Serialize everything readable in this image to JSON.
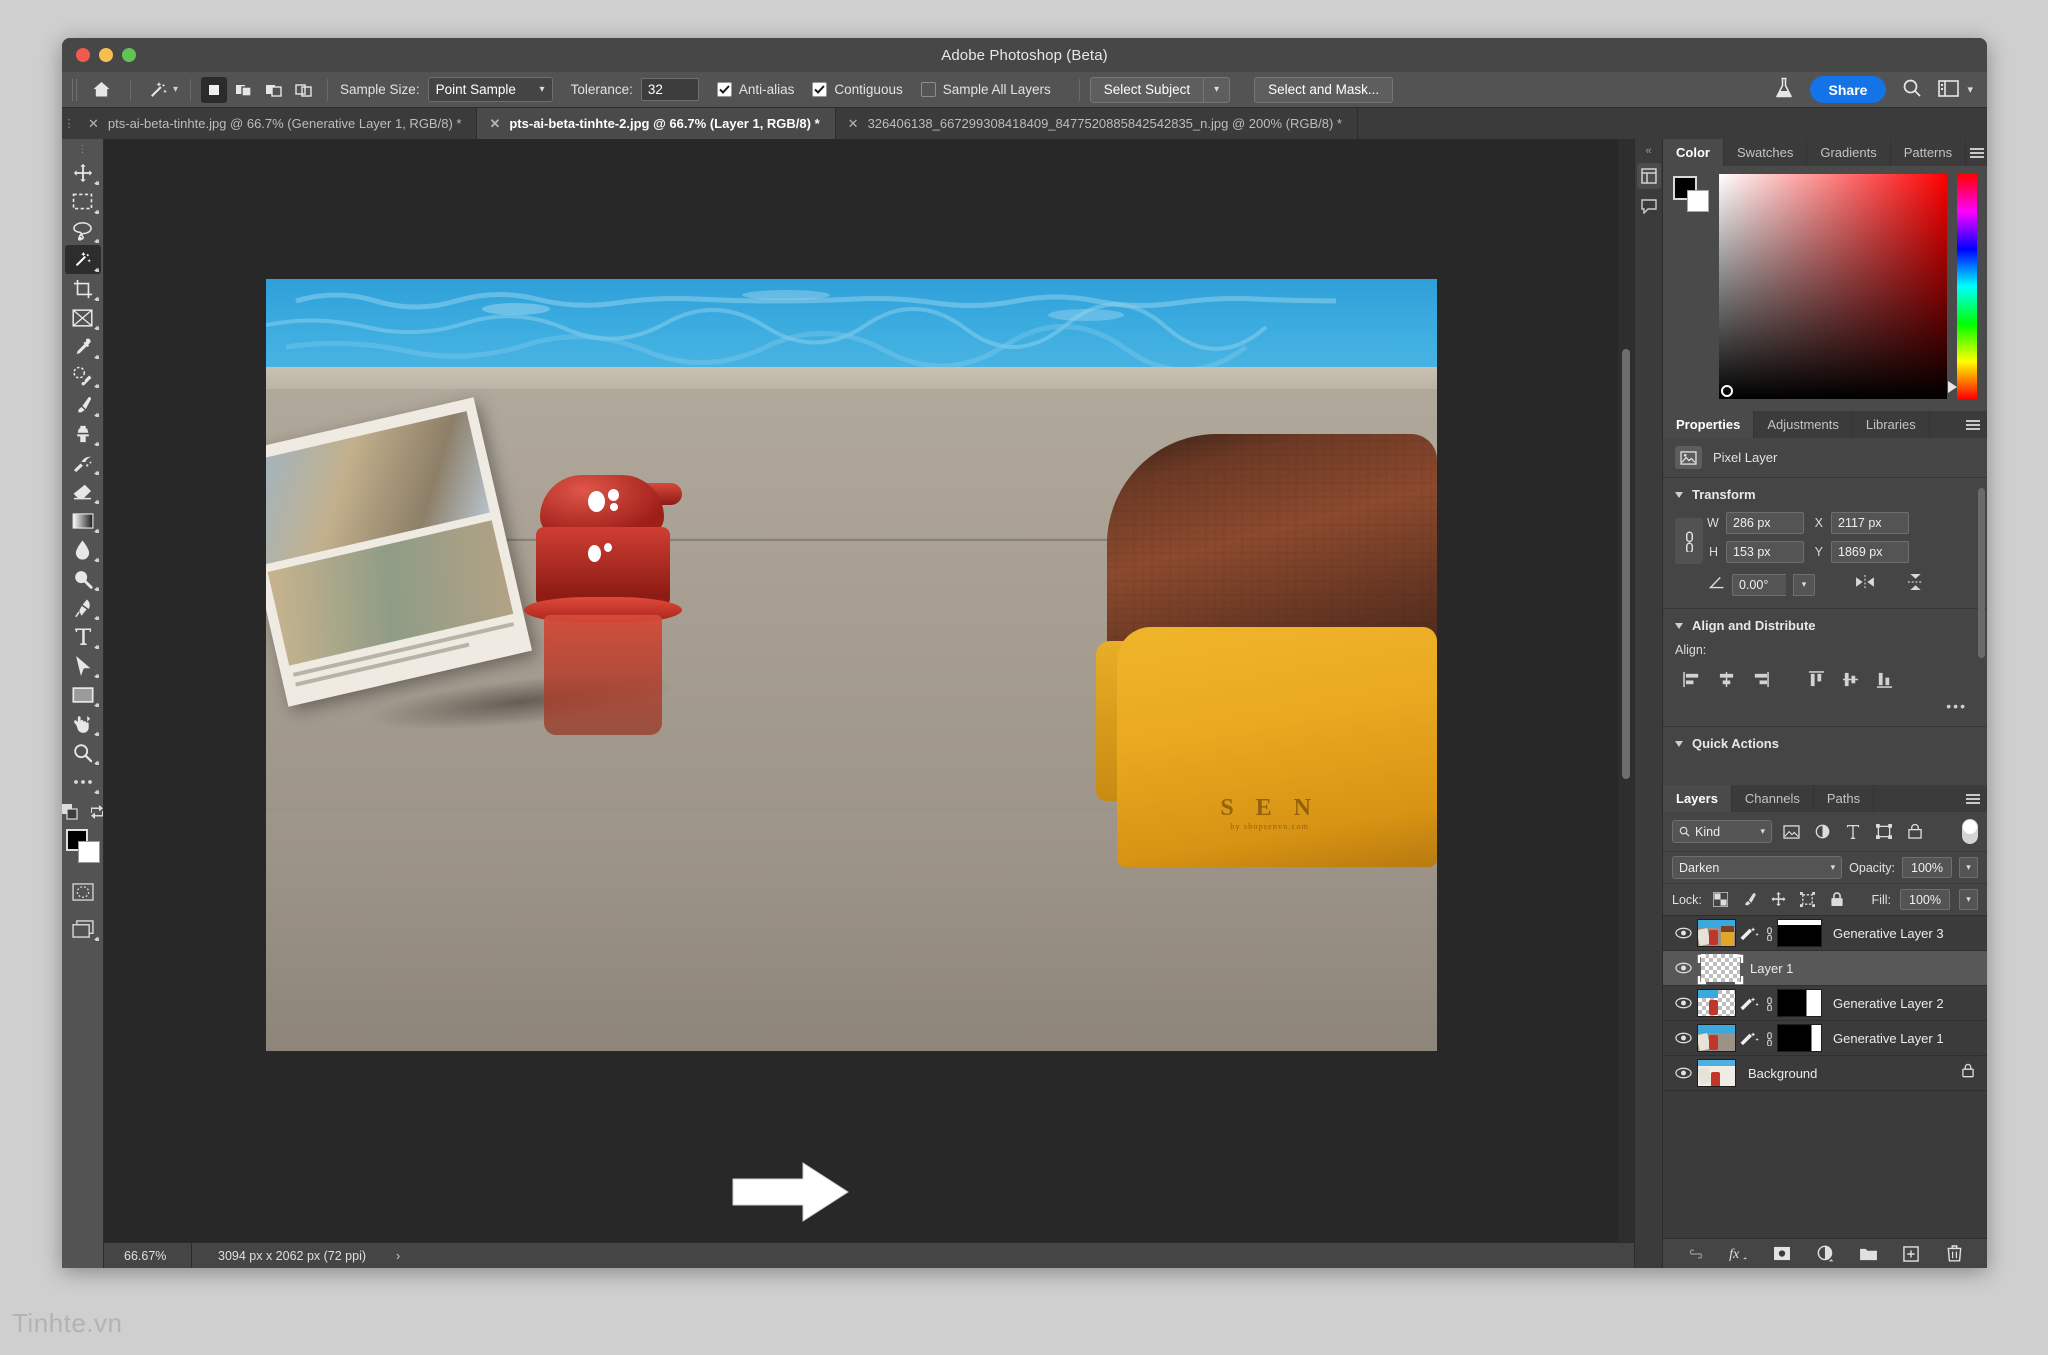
{
  "window": {
    "title": "Adobe Photoshop (Beta)",
    "traffic_lights": [
      "close",
      "minimize",
      "zoom"
    ]
  },
  "options_bar": {
    "home_icon": "home-icon",
    "tool_icon": "magic-wand-icon",
    "selection_modes": [
      "new-selection",
      "add-to-selection",
      "subtract-from-selection",
      "intersect-selection"
    ],
    "sample_size_label": "Sample Size:",
    "sample_size_value": "Point Sample",
    "tolerance_label": "Tolerance:",
    "tolerance_value": "32",
    "anti_alias_label": "Anti-alias",
    "anti_alias_checked": true,
    "contiguous_label": "Contiguous",
    "contiguous_checked": true,
    "sample_all_layers_label": "Sample All Layers",
    "sample_all_layers_checked": false,
    "select_subject_label": "Select Subject",
    "select_and_mask_label": "Select and Mask...",
    "flask_icon": "flask-icon",
    "share_label": "Share",
    "search_icon": "search-icon",
    "workspace_icon": "workspace-icon"
  },
  "tabs": [
    {
      "label": "pts-ai-beta-tinhte.jpg @ 66.7% (Generative Layer 1, RGB/8) *",
      "active": false
    },
    {
      "label": "pts-ai-beta-tinhte-2.jpg @ 66.7% (Layer 1, RGB/8) *",
      "active": true
    },
    {
      "label": "326406138_667299308418409_8477520885842542835_n.jpg @ 200% (RGB/8) *",
      "active": false
    }
  ],
  "toolbar": {
    "tools": [
      {
        "name": "move-tool",
        "icon": "move-icon",
        "active": false
      },
      {
        "name": "rectangular-marquee-tool",
        "icon": "marquee-icon",
        "active": false
      },
      {
        "name": "lasso-tool",
        "icon": "lasso-icon",
        "active": false
      },
      {
        "name": "object-selection-tool",
        "icon": "magic-wand-icon",
        "active": true
      },
      {
        "name": "crop-tool",
        "icon": "crop-icon",
        "active": false
      },
      {
        "name": "frame-tool",
        "icon": "frame-icon",
        "active": false
      },
      {
        "name": "eyedropper-tool",
        "icon": "eyedropper-icon",
        "active": false
      },
      {
        "name": "spot-healing-brush-tool",
        "icon": "healing-brush-icon",
        "active": false
      },
      {
        "name": "brush-tool",
        "icon": "brush-icon",
        "active": false
      },
      {
        "name": "clone-stamp-tool",
        "icon": "clone-stamp-icon",
        "active": false
      },
      {
        "name": "history-brush-tool",
        "icon": "history-brush-icon",
        "active": false
      },
      {
        "name": "eraser-tool",
        "icon": "eraser-icon",
        "active": false
      },
      {
        "name": "gradient-tool",
        "icon": "gradient-icon",
        "active": false
      },
      {
        "name": "blur-tool",
        "icon": "blur-drop-icon",
        "active": false
      },
      {
        "name": "dodge-tool",
        "icon": "dodge-icon",
        "active": false
      },
      {
        "name": "pen-tool",
        "icon": "pen-icon",
        "active": false
      },
      {
        "name": "type-tool",
        "icon": "type-t-icon",
        "active": false
      },
      {
        "name": "path-selection-tool",
        "icon": "arrow-cursor-icon",
        "active": false
      },
      {
        "name": "rectangle-tool",
        "icon": "rectangle-icon",
        "active": false
      },
      {
        "name": "hand-tool",
        "icon": "hand-icon",
        "active": false
      },
      {
        "name": "zoom-tool",
        "icon": "magnifier-icon",
        "active": false
      },
      {
        "name": "edit-toolbar",
        "icon": "more-dots-icon",
        "active": false
      }
    ],
    "default_colors_icon": "default-colors-icon",
    "swap_colors_icon": "swap-colors-icon",
    "foreground_color": "#000000",
    "background_color": "#ffffff",
    "quick_mask_icon": "quick-mask-icon",
    "screen_mode_icon": "screen-mode-icon"
  },
  "mini_dock": {
    "items": [
      {
        "name": "properties-dock-icon",
        "selected": true
      },
      {
        "name": "comments-dock-icon",
        "selected": false
      }
    ],
    "collapse_icon": "collapse-chevrons-icon"
  },
  "color_panel": {
    "tabs": [
      "Color",
      "Swatches",
      "Gradients",
      "Patterns"
    ],
    "active_tab": "Color",
    "foreground": "#000000",
    "background": "#ffffff",
    "hue": "#ff0000"
  },
  "properties_panel": {
    "tabs": [
      "Properties",
      "Adjustments",
      "Libraries"
    ],
    "active_tab": "Properties",
    "layer_type": "Pixel Layer",
    "layer_type_icon": "pixel-layer-icon",
    "transform": {
      "title": "Transform",
      "link_icon": "link-aspect-icon",
      "w_label": "W",
      "w_value": "286 px",
      "h_label": "H",
      "h_value": "153 px",
      "x_label": "X",
      "x_value": "2117 px",
      "y_label": "Y",
      "y_value": "1869 px",
      "angle_icon": "angle-icon",
      "angle_value": "0.00°",
      "flip_horizontal_icon": "flip-horizontal-icon",
      "flip_vertical_icon": "flip-vertical-icon"
    },
    "align": {
      "title": "Align and Distribute",
      "label": "Align:",
      "buttons": [
        "align-left-edges-icon",
        "align-horizontal-centers-icon",
        "align-right-edges-icon",
        "align-top-edges-icon",
        "align-vertical-centers-icon",
        "align-bottom-edges-icon"
      ],
      "more_icon": "more-dots-icon"
    },
    "quick_actions": {
      "title": "Quick Actions"
    }
  },
  "layers_panel": {
    "tabs": [
      "Layers",
      "Channels",
      "Paths"
    ],
    "active_tab": "Layers",
    "filter_label": "Kind",
    "filter_icons": [
      "filter-pixel-icon",
      "filter-adjustment-icon",
      "filter-type-icon",
      "filter-shape-icon",
      "filter-smart-object-icon"
    ],
    "filter_toggle": "filter-enable-toggle",
    "blend_mode": "Darken",
    "opacity_label": "Opacity:",
    "opacity_value": "100%",
    "lock_label": "Lock:",
    "lock_icons": [
      "lock-transparent-pixels-icon",
      "lock-image-pixels-icon",
      "lock-position-icon",
      "lock-artboard-nesting-icon",
      "lock-all-icon"
    ],
    "fill_label": "Fill:",
    "fill_value": "100%",
    "layers": [
      {
        "name": "Generative Layer 3",
        "visible": true,
        "selected": false,
        "kind": "generative",
        "mask": "mostly-black",
        "locked": false
      },
      {
        "name": "Layer 1",
        "visible": true,
        "selected": true,
        "kind": "empty",
        "mask": "none",
        "locked": false
      },
      {
        "name": "Generative Layer 2",
        "visible": true,
        "selected": false,
        "kind": "generative-transparent",
        "mask": "black-white-right",
        "locked": false
      },
      {
        "name": "Generative Layer 1",
        "visible": true,
        "selected": false,
        "kind": "generative",
        "mask": "black-white-wide",
        "locked": false
      },
      {
        "name": "Background",
        "visible": true,
        "selected": false,
        "kind": "photo",
        "mask": "none",
        "locked": true
      }
    ],
    "bottom_icons": [
      "link-layers-icon",
      "layer-style-fx-icon",
      "add-layer-mask-icon",
      "new-fill-adjustment-layer-icon",
      "new-group-icon",
      "new-layer-icon",
      "delete-layer-icon"
    ]
  },
  "status_bar": {
    "zoom": "66.67%",
    "doc_size": "3094 px x 2062 px (72 ppi)",
    "expand_icon": "chevron-right-icon"
  },
  "canvas": {
    "annotation_arrow": "white-arrow-annotation",
    "leather_brand_text": "S E N",
    "leather_brand_sub": "by shopsenvn.com"
  },
  "watermark": {
    "text": "Tinhte.vn"
  }
}
